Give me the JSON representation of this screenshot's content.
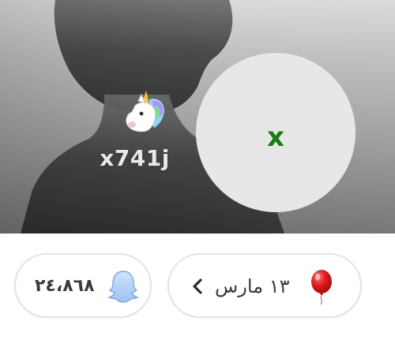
{
  "profile": {
    "username": "x741j",
    "avatar_initial": "x",
    "badge_icon": "unicorn-icon",
    "avatar_text_color": "#1b7a14"
  },
  "stats": {
    "snap_score": {
      "icon": "ghost-icon",
      "value": "٢٤،٨٦٨"
    },
    "birthday": {
      "icon": "balloon-icon",
      "value": "١٣ مارس",
      "chevron": "chevron-left-icon"
    }
  }
}
